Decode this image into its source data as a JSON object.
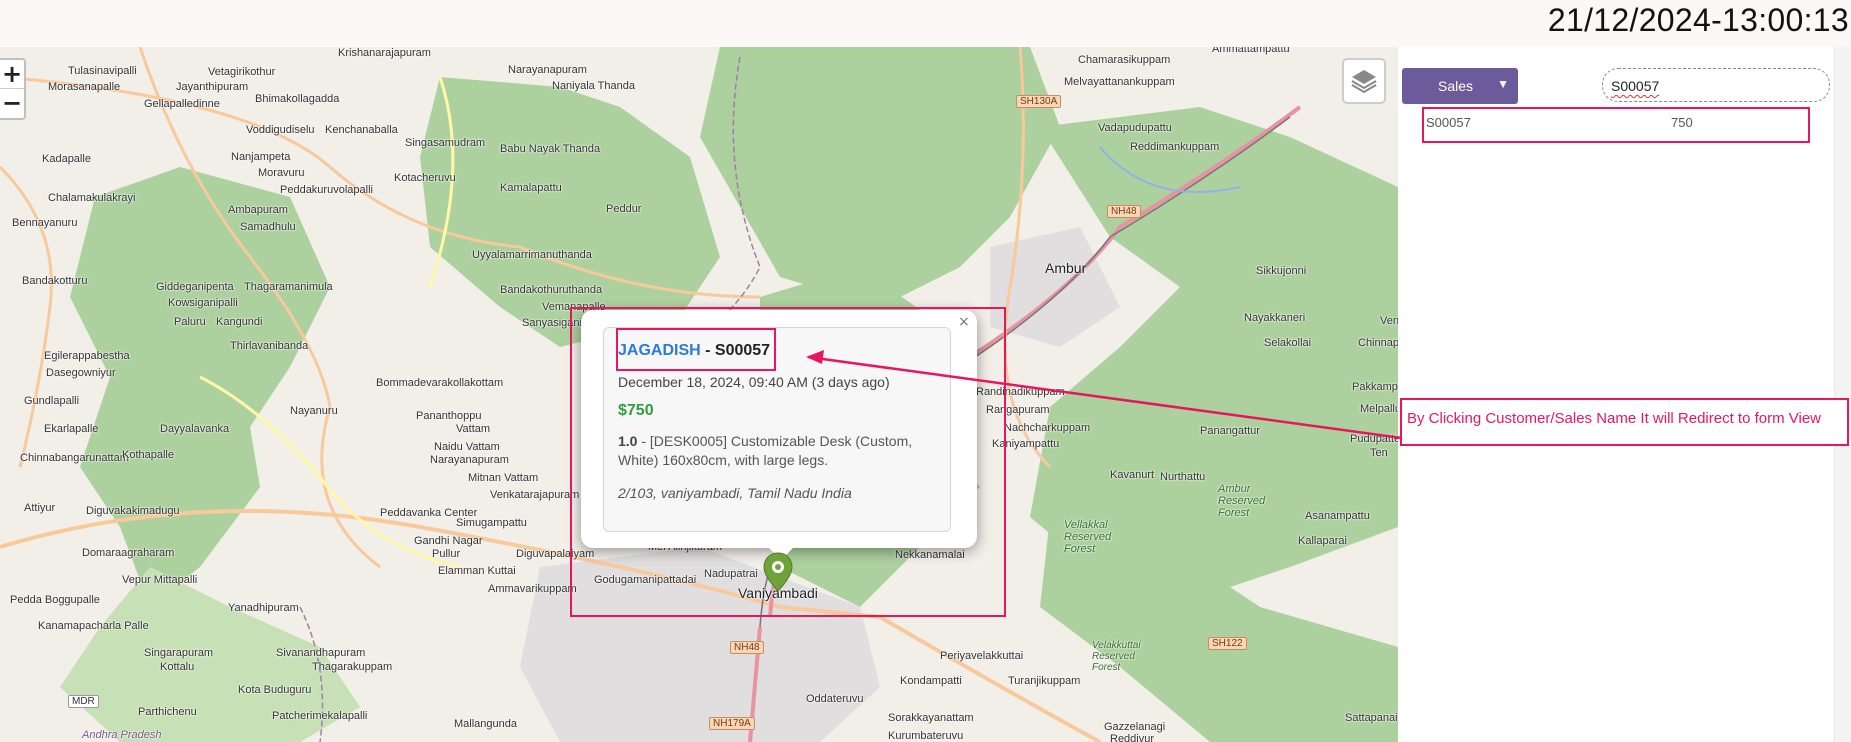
{
  "header": {
    "datetime": "21/12/2024-13:00:13"
  },
  "map": {
    "zoom_in": "+",
    "zoom_out": "−",
    "places": [
      {
        "name": "Tulasinavipalli"
      },
      {
        "name": "Morasanapalle"
      },
      {
        "name": "Jayanthipuram"
      },
      {
        "name": "Vetagirikothur"
      },
      {
        "name": "Krishanarajapuram"
      },
      {
        "name": "Narayanapuram"
      },
      {
        "name": "Naniyala Thanda"
      },
      {
        "name": "Gellapalledinne"
      },
      {
        "name": "Bhimakollagadda"
      },
      {
        "name": "Singasamudram"
      },
      {
        "name": "Babu Nayak Thanda"
      },
      {
        "name": "Kenchanaballa"
      },
      {
        "name": "Voddigudiselu"
      },
      {
        "name": "Kadapalle"
      },
      {
        "name": "Nanjampeta"
      },
      {
        "name": "Moravuru"
      },
      {
        "name": "Peddakuruvolapalli"
      },
      {
        "name": "Kotacheruvu"
      },
      {
        "name": "Kamalapattu"
      },
      {
        "name": "Chalamakulakrayi"
      },
      {
        "name": "Peddur"
      },
      {
        "name": "Bennayanuru"
      },
      {
        "name": "Ambapuram"
      },
      {
        "name": "Samadhulu"
      },
      {
        "name": "Uyyalamarrimanuthanda"
      },
      {
        "name": "Bandakotturu"
      },
      {
        "name": "Giddeganipenta"
      },
      {
        "name": "Thagaramanimula"
      },
      {
        "name": "Kowsiganipalli"
      },
      {
        "name": "Bandakothuruthanda"
      },
      {
        "name": "Vemanapalle"
      },
      {
        "name": "Sanyasiganipalli"
      },
      {
        "name": "Paluru"
      },
      {
        "name": "Kangundi"
      },
      {
        "name": "Thirlavanibanda"
      },
      {
        "name": "Egilerappabestha"
      },
      {
        "name": "Dasegowniyur"
      },
      {
        "name": "Bommadevarakollakottam"
      },
      {
        "name": "Gundlapalli"
      },
      {
        "name": "Nayanuru"
      },
      {
        "name": "Pananthoppu"
      },
      {
        "name": "Vattam"
      },
      {
        "name": "Ekarlapalle"
      },
      {
        "name": "Dayyalavanka"
      },
      {
        "name": "Naidu Vattam"
      },
      {
        "name": "Narayanapuram"
      },
      {
        "name": "Chinnabangarunattam"
      },
      {
        "name": "Kothapalle"
      },
      {
        "name": "Mitnan Vattam"
      },
      {
        "name": "Venkatarajapuram"
      },
      {
        "name": "Attiyur"
      },
      {
        "name": "Diguvakakimadugu"
      },
      {
        "name": "Peddavanka Center"
      },
      {
        "name": "Simugampattu"
      },
      {
        "name": "Gandhi Nagar"
      },
      {
        "name": "Pullur"
      },
      {
        "name": "Diguvapalaiyam"
      },
      {
        "name": "Domaraagraharam"
      },
      {
        "name": "Elamman Kuttai"
      },
      {
        "name": "Vepur Mittapalli"
      },
      {
        "name": "Ammavarikuppam"
      },
      {
        "name": "Godugamanipattadai"
      },
      {
        "name": "Nadupatrai"
      },
      {
        "name": "Pedda Boggupalle"
      },
      {
        "name": "Yanadhipuram"
      },
      {
        "name": "Kanamapacharla Palle"
      },
      {
        "name": "Singarapuram"
      },
      {
        "name": "Sivanandhapuram"
      },
      {
        "name": "Kottalu"
      },
      {
        "name": "Thagarakuppam"
      },
      {
        "name": "Kota Buduguru"
      },
      {
        "name": "Parthichenu"
      },
      {
        "name": "Patcherimekalapalli"
      },
      {
        "name": "Mallangunda"
      },
      {
        "name": "Chamarasikuppam"
      },
      {
        "name": "Ammattampattu"
      },
      {
        "name": "Melvayattanankuppam"
      },
      {
        "name": "Vadapudupattu"
      },
      {
        "name": "Reddimankuppam"
      },
      {
        "name": "Sikkujonni"
      },
      {
        "name": "Nayakkaneri"
      },
      {
        "name": "Selakollai"
      },
      {
        "name": "Chinnap"
      },
      {
        "name": "Venc"
      },
      {
        "name": "Pakkamp"
      },
      {
        "name": "Melpallu"
      },
      {
        "name": "Pudupatte"
      },
      {
        "name": "Ten"
      },
      {
        "name": "Panangattur"
      },
      {
        "name": "Kavanurt"
      },
      {
        "name": "Nurthattu"
      },
      {
        "name": "Ambur Reserved Forest"
      },
      {
        "name": "Asanampattu"
      },
      {
        "name": "Kallaparai"
      },
      {
        "name": "Vellakkal Reserved Forest"
      },
      {
        "name": "Nekkanamalai"
      },
      {
        "name": "Periyavelakkuttai"
      },
      {
        "name": "Kondampatti"
      },
      {
        "name": "Turanjikuppam"
      },
      {
        "name": "Oddateruvu"
      },
      {
        "name": "Sorakkayanattam"
      },
      {
        "name": "Kurumbateruvu"
      },
      {
        "name": "Velakkuttai Reserved Forest"
      },
      {
        "name": "Sattapanai"
      },
      {
        "name": "Gazzelanagi"
      },
      {
        "name": "Reddivur"
      },
      {
        "name": "Randinadikuppam"
      },
      {
        "name": "Rangapuram"
      },
      {
        "name": "Nachcharkuppam"
      },
      {
        "name": "Kaniyampattu"
      },
      {
        "name": "Mel Alinjikuram"
      },
      {
        "name": "Andhra Pradesh"
      }
    ],
    "towns": [
      {
        "name": "Ambur"
      },
      {
        "name": "Vaniyambadi"
      }
    ],
    "shields": [
      "SH130A",
      "NH48",
      "NH48",
      "NH179A",
      "SH122",
      "MDR"
    ]
  },
  "popup": {
    "close": "×",
    "customer": "JAGADISH",
    "separator": " - ",
    "reference": "S00057",
    "date": "December 18, 2024, 09:40 AM (3 days ago)",
    "amount": "$750",
    "line_qty": "1.0",
    "line_desc": " - [DESK0005] Customizable Desk (Custom, White) 160x80cm, with large legs.",
    "address": "2/103, vaniyambadi, Tamil Nadu India"
  },
  "panel": {
    "model_select": "Sales",
    "search_value": "S00057",
    "results": [
      {
        "ref": "S00057",
        "amount": "750"
      }
    ]
  },
  "annotation": {
    "note": "By Clicking Customer/Sales Name It will Redirect to form View",
    "color": "#e8175d"
  }
}
